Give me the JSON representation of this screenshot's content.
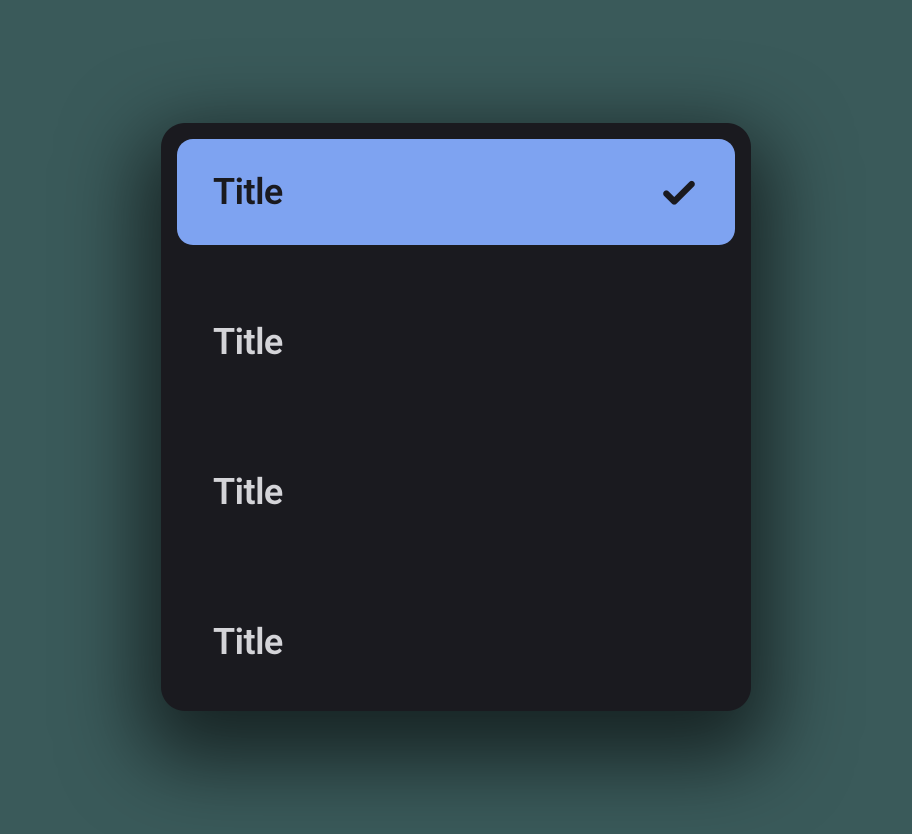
{
  "menu": {
    "items": [
      {
        "label": "Title",
        "selected": true
      },
      {
        "label": "Title",
        "selected": false
      },
      {
        "label": "Title",
        "selected": false
      },
      {
        "label": "Title",
        "selected": false
      }
    ]
  },
  "colors": {
    "background": "#3a5a5a",
    "card": "#1a1a1f",
    "selected": "#7ea3f1",
    "textLight": "#d4d4d8",
    "textDark": "#1a1a1f"
  }
}
